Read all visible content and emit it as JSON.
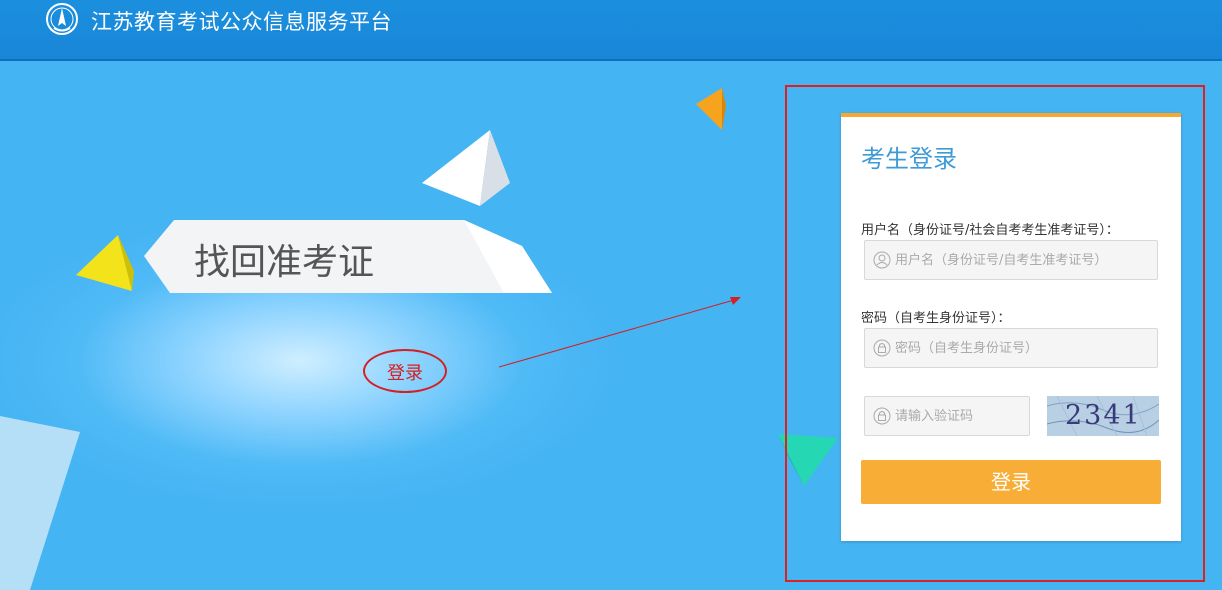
{
  "header": {
    "site_title": "江苏教育考试公众信息服务平台",
    "logo_icon": "exam-authority-logo-icon"
  },
  "hero": {
    "retrieve_label": "找回准考证",
    "annotation_label": "登录",
    "annotation_color": "#d42020"
  },
  "login_panel": {
    "title": "考生登录",
    "username": {
      "label": "用户名（身份证号/社会自考考生准考证号）：",
      "placeholder": "用户名（身份证号/自考生准考证号）",
      "icon": "user-icon"
    },
    "password": {
      "label": "密码（自考生身份证号）：",
      "placeholder": "密码（自考生身份证号）",
      "icon": "lock-icon"
    },
    "captcha": {
      "placeholder": "请输入验证码",
      "icon": "lock-icon",
      "image_text": "2341"
    },
    "submit_label": "登录",
    "accent_color": "#f7a82d"
  }
}
